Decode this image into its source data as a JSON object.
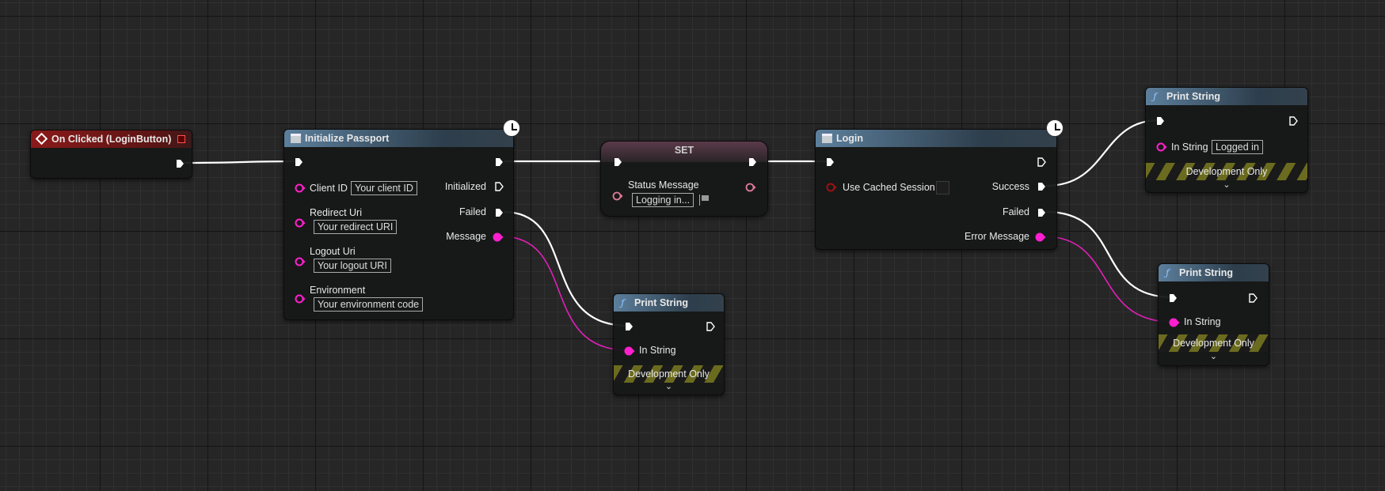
{
  "colors": {
    "exec": "#ffffff",
    "string": "#ff1fce",
    "set_pin": "#e07a9a",
    "bool": "#8c0d0d",
    "event_header": "#8a1a1a",
    "function_header": "#5c7f9c"
  },
  "on_clicked": {
    "title": "On Clicked (LoginButton)",
    "icon": "event-diamond-icon"
  },
  "init_passport": {
    "title": "Initialize Passport",
    "icon": "function-node-icon",
    "latent_icon": "clock-icon",
    "inputs": [
      {
        "label": "Client ID",
        "value": "Your client ID"
      },
      {
        "label": "Redirect Uri",
        "value": "Your redirect URI"
      },
      {
        "label": "Logout Uri",
        "value": "Your logout URI"
      },
      {
        "label": "Environment",
        "value": "Your environment code"
      }
    ],
    "outputs": [
      "Initialized",
      "Failed",
      "Message"
    ]
  },
  "set_node": {
    "title": "SET",
    "variable": "Status Message",
    "value": "Logging in..."
  },
  "login": {
    "title": "Login",
    "latent_icon": "clock-icon",
    "input": "Use Cached Session",
    "use_cached_session": false,
    "outputs": [
      "Success",
      "Failed",
      "Error Message"
    ]
  },
  "print_success": {
    "title": "Print String",
    "in_label": "In String",
    "value": "Logged in",
    "footer": "Development Only"
  },
  "print_login_failed": {
    "title": "Print String",
    "in_label": "In String",
    "footer": "Development Only"
  },
  "print_init_failed": {
    "title": "Print String",
    "in_label": "In String",
    "footer": "Development Only"
  }
}
